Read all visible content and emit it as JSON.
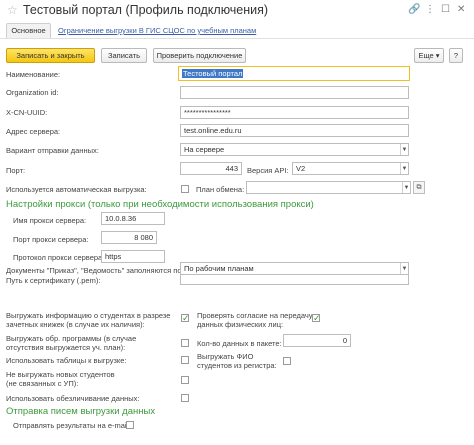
{
  "window": {
    "title": "Тестовый портал (Профиль подключения)",
    "icons": [
      "link-icon",
      "more-vertical-icon",
      "maximize-icon",
      "close-icon"
    ]
  },
  "nav": {
    "main_tab": "Основное",
    "link": "Ограничение выгрузки В ГИС СЦОС по учебным планам"
  },
  "toolbar": {
    "save_close": "Записать и закрыть",
    "save": "Записать",
    "check": "Проверить подключение",
    "more": "Еще",
    "help": "?"
  },
  "fields": {
    "name_label": "Наименование:",
    "name_value": "Тестовый портал",
    "org_label": "Organization id:",
    "org_value": "",
    "uuid_label": "X-CN-UUID:",
    "uuid_value": "****************",
    "server_label": "Адрес сервера:",
    "server_value": "test.online.edu.ru",
    "variant_label": "Вариант отправки данных:",
    "variant_value": "На сервере",
    "port_label": "Порт:",
    "port_value": "443",
    "api_label": "Версия API:",
    "api_value": "V2",
    "auto_label": "Используется автоматическая выгрузка:",
    "plan_label": "План обмена:",
    "plan_value": ""
  },
  "proxy": {
    "section": "Настройки прокси (только при необходимости использования прокси)",
    "server_label": "Имя прокси сервера:",
    "server_value": "10.0.8.36",
    "port_label": "Порт прокси сервера:",
    "port_value": "8 080",
    "protocol_label": "Протокол прокси сервера:",
    "protocol_value": "https"
  },
  "more_fields": {
    "cert_label": "Путь к сертификату (.pem):",
    "cert_value": "",
    "docs_label": "Документы \"Приказ\", \"Ведомость\" заполняются по:",
    "docs_value": "По рабочим планам",
    "students_label_1": "Выгружать информацию о студентах в разрезе",
    "students_label_2": "зачетных книжек (в случае их наличия):",
    "consent_label_1": "Проверять согласие на передачу",
    "consent_label_2": "данных физических лиц:",
    "programs_label_1": "Выгружать обр. программы (в случае",
    "programs_label_2": "отсутствия выгружается уч. план):",
    "packet_label": "Кол-во данных в пакете:",
    "packet_value": "0",
    "tables_label": "Использовать таблицы к выгрузке:",
    "fio_label_1": "Выгружать ФИО",
    "fio_label_2": "студентов из регистра:",
    "new_students_label_1": "Не выгружать новых студентов",
    "new_students_label_2": "(не связанных с УП):",
    "depersonal_label": "Использовать обезличивание данных:"
  },
  "mail": {
    "section": "Отправка писем выгрузки данных",
    "send_label": "Отправлять результаты на e-mail:"
  }
}
